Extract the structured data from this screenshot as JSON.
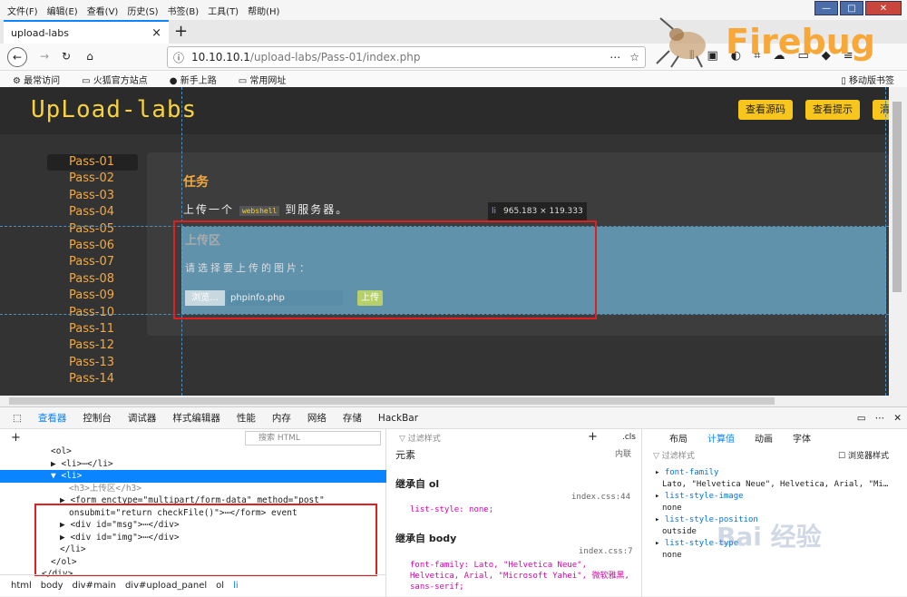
{
  "menu": [
    "文件(F)",
    "编辑(E)",
    "查看(V)",
    "历史(S)",
    "书签(B)",
    "工具(T)",
    "帮助(H)"
  ],
  "tab": {
    "title": "upload-labs",
    "close": "×",
    "new": "+"
  },
  "url": {
    "host": "10.10.10.1",
    "path": "/upload-labs/Pass-01/index.php"
  },
  "bookmarks": [
    "最常访问",
    "火狐官方站点",
    "新手上路",
    "常用网址"
  ],
  "mobile_bookmarks": "移动版书签",
  "firebug": "Firebug",
  "site": {
    "logo": "UpLoad-labs",
    "btn_source": "查看源码",
    "btn_hint": "查看提示",
    "btn_clear": "清",
    "passes": [
      "Pass-01",
      "Pass-02",
      "Pass-03",
      "Pass-04",
      "Pass-05",
      "Pass-06",
      "Pass-07",
      "Pass-08",
      "Pass-09",
      "Pass-10",
      "Pass-11",
      "Pass-12",
      "Pass-13",
      "Pass-14"
    ],
    "task_title": "任务",
    "task_desc_pre": "上传一个",
    "task_code": "webshell",
    "task_desc_post": "到服务器。",
    "upload_title": "上传区",
    "upload_label": "请选择要上传的图片：",
    "browse": "浏览...",
    "filename": "phpinfo.php",
    "upload_btn": "上传"
  },
  "tooltip": {
    "tag": "li",
    "size": "965.183 × 119.333"
  },
  "devtools": {
    "tabs": [
      "查看器",
      "控制台",
      "调试器",
      "样式编辑器",
      "性能",
      "内存",
      "网络",
      "存储",
      "HackBar"
    ],
    "search_placeholder": "搜索 HTML",
    "tree": [
      "<ol>",
      "▶ <li>⋯</li>",
      "▼ <li>",
      "<h3>上传区</h3>",
      "▶ <form enctype=\"multipart/form-data\" method=\"post\"",
      "onsubmit=\"return checkFile()\">⋯</form> event",
      "▶ <div id=\"msg\">⋯</div>",
      "▶ <div id=\"img\">⋯</div>",
      "</li>",
      "</ol>",
      "</div>"
    ],
    "breadcrumb": [
      "html",
      "body",
      "div#main",
      "div#upload_panel",
      "ol",
      "li"
    ],
    "filter_styles": "过滤样式",
    "element": "元素",
    "inline": "内联",
    "inherit_ol": "继承自 ol",
    "ol_src": "index.css:44",
    "ol_rule": "list-style: none;",
    "inherit_body": "继承自 body",
    "body_src": "index.css:7",
    "body_rule": "font-family: Lato, \"Helvetica Neue\", Helvetica, Arial, \"Microsoft Yahei\", 微软雅黑, sans-serif;",
    "right_tabs": [
      "布局",
      "计算值",
      "动画",
      "字体"
    ],
    "browser_styles": "浏览器样式",
    "computed": [
      {
        "prop": "font-family",
        "val": "Lato, \"Helvetica Neue\", Helvetica, Arial, \"Mi…"
      },
      {
        "prop": "list-style-image",
        "val": "none"
      },
      {
        "prop": "list-style-position",
        "val": "outside"
      },
      {
        "prop": "list-style-type",
        "val": "none"
      }
    ]
  },
  "watermark": "Bai 经验"
}
